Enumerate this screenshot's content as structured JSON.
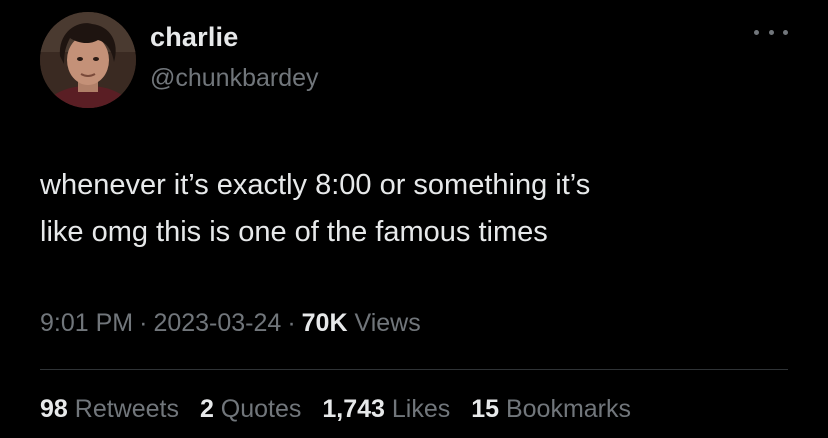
{
  "author": {
    "display_name": "charlie",
    "handle": "@chunkbardey"
  },
  "tweet": {
    "text": "whenever it’s exactly 8:00 or something it’s\nlike omg this is one of the famous times"
  },
  "meta": {
    "time": "9:01 PM",
    "separator": "·",
    "date": "2023-03-24",
    "views_count": "70K",
    "views_label": "Views"
  },
  "stats": {
    "retweets": {
      "count": "98",
      "label": "Retweets"
    },
    "quotes": {
      "count": "2",
      "label": "Quotes"
    },
    "likes": {
      "count": "1,743",
      "label": "Likes"
    },
    "bookmarks": {
      "count": "15",
      "label": "Bookmarks"
    }
  },
  "icons": {
    "more": "more-horizontal-icon"
  },
  "colors": {
    "background": "#000000",
    "primary_text": "#e7e9ea",
    "secondary_text": "#71767b",
    "divider": "#2f3336"
  }
}
